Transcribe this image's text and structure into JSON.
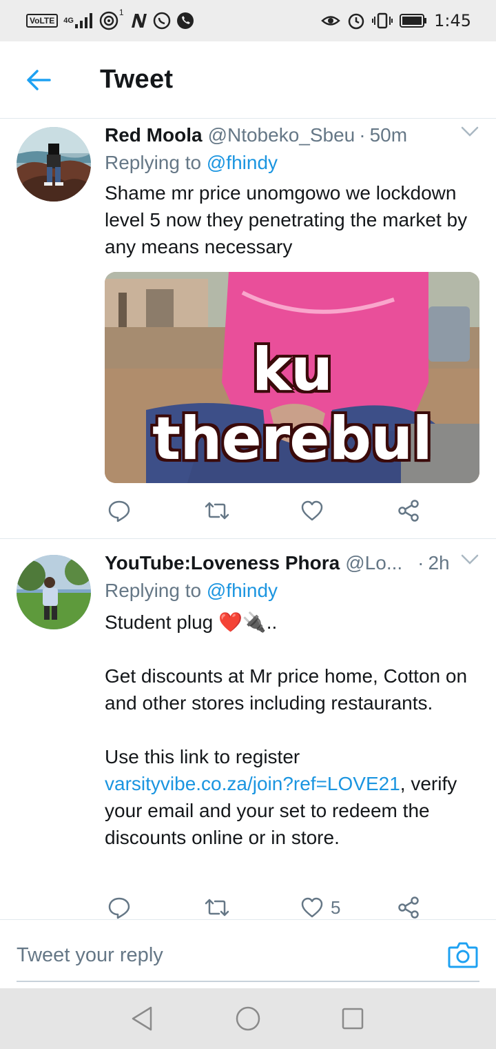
{
  "status_bar": {
    "volte": "VoLTE",
    "network": "4G",
    "wifi_count": "1",
    "time": "1:45"
  },
  "header": {
    "title": "Tweet"
  },
  "tweets": [
    {
      "name": "Red Moola",
      "handle": "@Ntobeko_Sbeu",
      "dot": "·",
      "time": "50m",
      "replying_prefix": "Replying to",
      "replying_to": "@fhindy",
      "text": "Shame mr price unomgowo we lockdown level 5 now they penetrating the market by any means necessary",
      "media_caption": "ku therebul",
      "likes": ""
    },
    {
      "name": "YouTube:Loveness Phora",
      "handle": "@Lo...",
      "dot": "·",
      "time": "2h",
      "replying_prefix": "Replying to",
      "replying_to": "@fhindy",
      "text_line1": "Student plug ❤️🔌..",
      "text_para2": "Get discounts at Mr price home, Cotton on and other stores including restaurants.",
      "text_para3_prefix": "Use this link to register",
      "link": "varsityvibe.co.za/join?ref=LOVE21",
      "text_para3_suffix": ", verify your email and your set to redeem the discounts online or in store.",
      "likes": "5"
    }
  ],
  "reply_bar": {
    "placeholder": "Tweet your reply"
  },
  "colors": {
    "accent": "#1da1f2",
    "link": "#1b95e0",
    "muted": "#657786",
    "text": "#14171a"
  },
  "icons": {
    "back": "arrow-left-icon",
    "chevron": "chevron-down-icon",
    "reply": "reply-bubble-icon",
    "retweet": "retweet-icon",
    "like": "heart-icon",
    "share": "share-icon",
    "camera": "camera-icon"
  }
}
